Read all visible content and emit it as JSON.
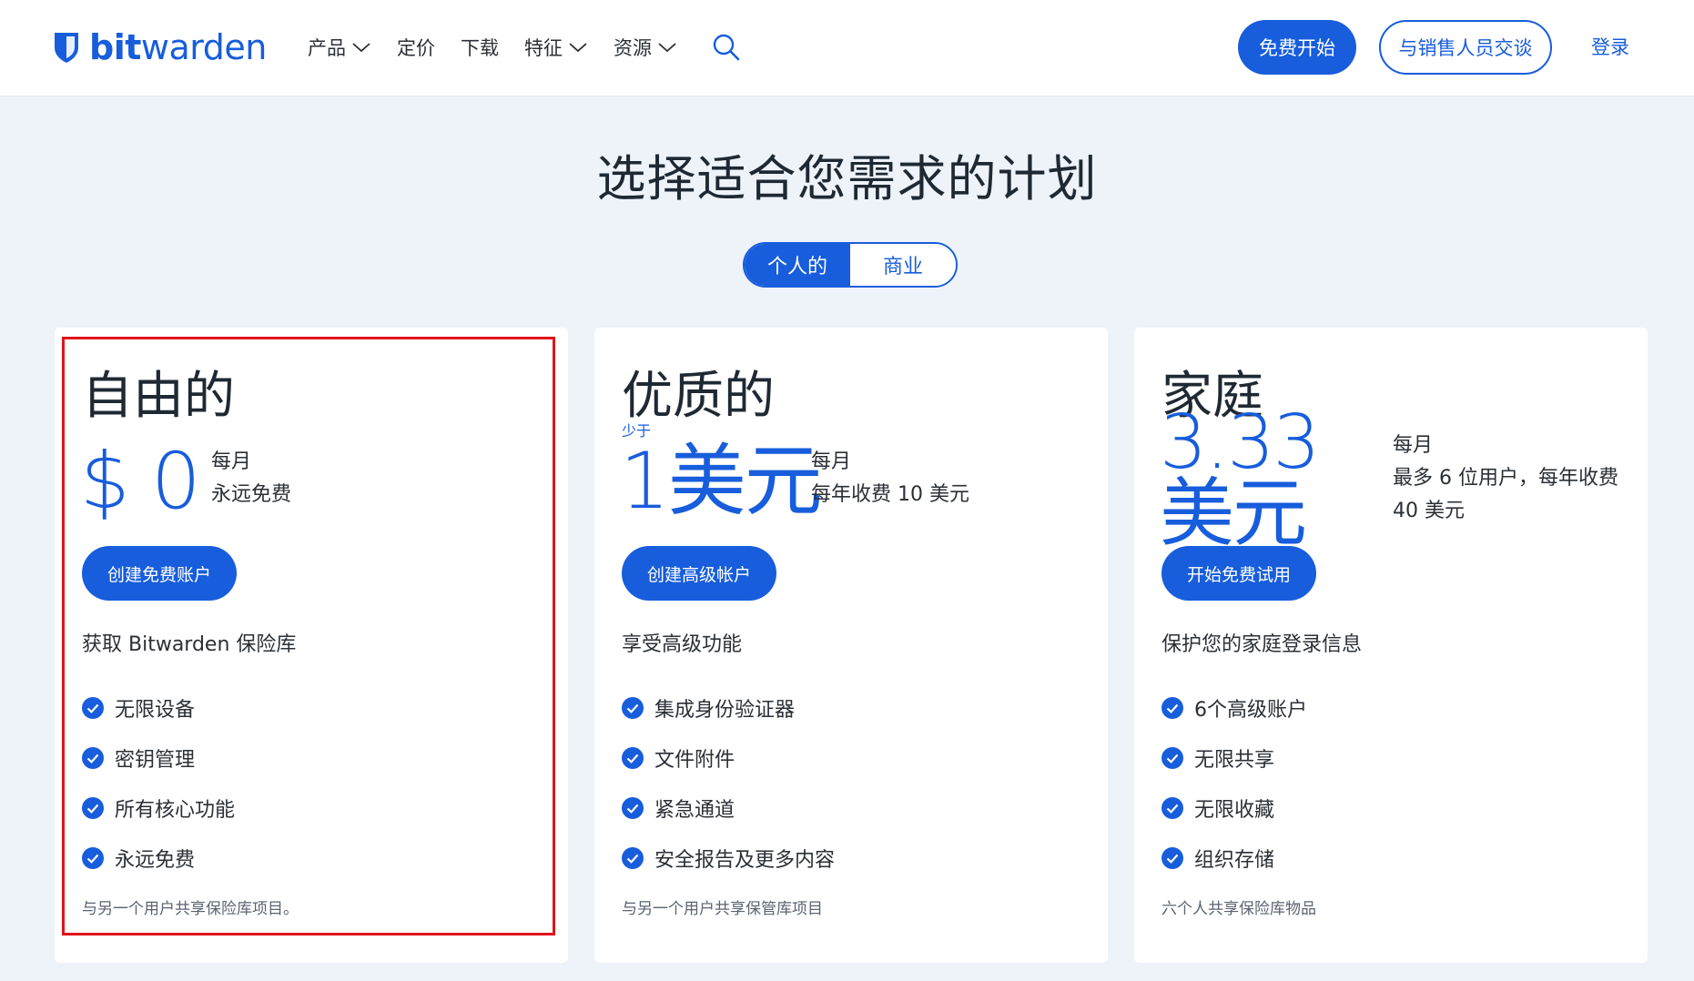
{
  "header": {
    "logo": {
      "bold": "bit",
      "regular": "warden"
    },
    "nav": [
      {
        "label": "产品",
        "has_dropdown": true
      },
      {
        "label": "定价",
        "has_dropdown": false
      },
      {
        "label": "下载",
        "has_dropdown": false
      },
      {
        "label": "特征",
        "has_dropdown": true
      },
      {
        "label": "资源",
        "has_dropdown": true
      }
    ],
    "search_icon": "search-icon",
    "start_free_label": "免费开始",
    "contact_sales_label": "与销售人员交谈",
    "login_label": "登录"
  },
  "page_title": "选择适合您需求的计划",
  "plan_toggle": {
    "options": [
      "个人的",
      "商业"
    ],
    "active": "个人的"
  },
  "plans": [
    {
      "title": "自由的",
      "price": "$ 0",
      "price_note": "",
      "period_line1": "每月",
      "period_line2": "永远免费",
      "button_label": "创建免费账户",
      "subtitle": "获取 Bitwarden 保险库",
      "features": [
        "无限设备",
        "密钥管理",
        "所有核心功能",
        "永远免费"
      ],
      "footnote": "与另一个用户共享保险库项目。"
    },
    {
      "title": "优质的",
      "price": "1美元",
      "price_note": "少于",
      "period_line1": "每月",
      "period_line2": "每年收费 10 美元",
      "button_label": "创建高级帐户",
      "subtitle": "享受高级功能",
      "features": [
        "集成身份验证器",
        "文件附件",
        "紧急通道",
        "安全报告及更多内容"
      ],
      "footnote": "与另一个用户共享保管库项目"
    },
    {
      "title": "家庭",
      "price": "3.33美元",
      "price_note": "",
      "period_line1": "每月",
      "period_line2": "最多 6 位用户，每年收费 40 美元",
      "button_label": "开始免费试用",
      "subtitle": "保护您的家庭登录信息",
      "features": [
        "6个高级账户",
        "无限共享",
        "无限收藏",
        "组织存储"
      ],
      "footnote": "六个人共享保险库物品"
    }
  ],
  "colors": {
    "brand_blue": "#175ddc",
    "background": "#eef3f9",
    "highlight_red": "#e0131b"
  }
}
